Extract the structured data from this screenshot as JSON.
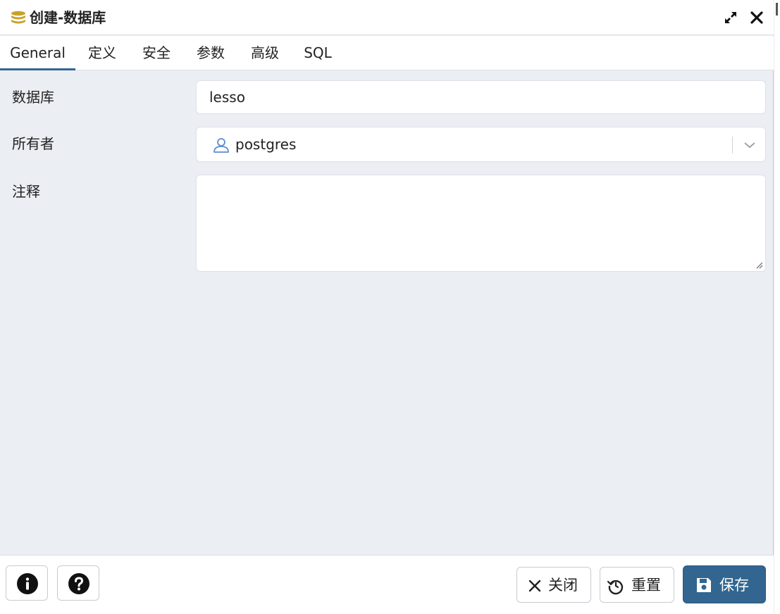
{
  "dialog": {
    "title": "创建-数据库",
    "icons": {
      "title_icon": "database-icon",
      "maximize": "expand-icon",
      "close": "close-icon"
    }
  },
  "tabs": [
    {
      "label": "General",
      "active": true
    },
    {
      "label": "定义"
    },
    {
      "label": "安全"
    },
    {
      "label": "参数"
    },
    {
      "label": "高级"
    },
    {
      "label": "SQL"
    }
  ],
  "form": {
    "database": {
      "label": "数据库",
      "value": "lesso"
    },
    "owner": {
      "label": "所有者",
      "value": "postgres",
      "icon": "user-icon"
    },
    "comment": {
      "label": "注释",
      "value": ""
    }
  },
  "footer": {
    "info_icon": "info-icon",
    "help_icon": "help-icon",
    "close_label": "关闭",
    "reset_label": "重置",
    "save_label": "保存"
  },
  "colors": {
    "accent": "#326690",
    "panel_bg": "#ebeef3",
    "db_icon": "#c9a227",
    "user_icon": "#5b8fd1"
  }
}
